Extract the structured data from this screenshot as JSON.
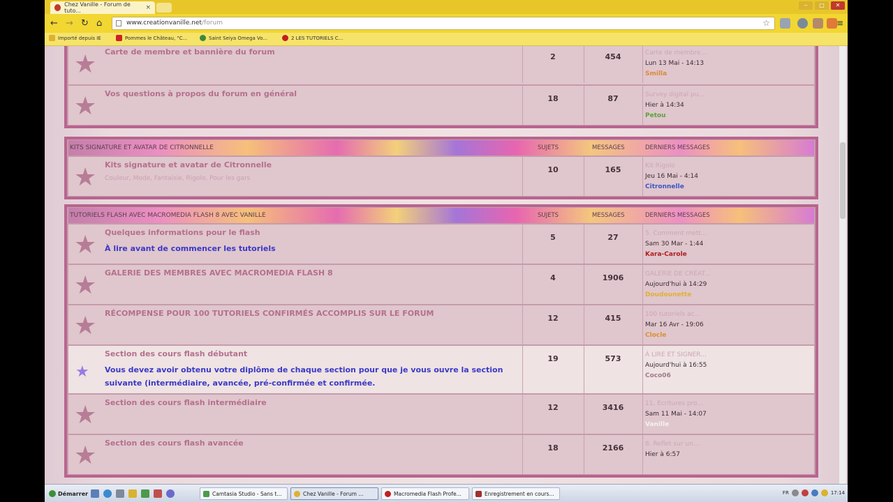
{
  "browser": {
    "tab_title": "Chez Vanille - Forum de tuto...",
    "tab_close": "×",
    "url_host": "www.creationvanille.net",
    "url_path": "/forum",
    "bookmarks": [
      "Importé depuis IE",
      "Pommes le Château, \"C...",
      "Saint Seiya Omega Vo...",
      "2 LES TUTORIELS C..."
    ],
    "colors": {
      "tabbar": "#e8c62a",
      "toolbar": "#f2d632"
    }
  },
  "categories": [
    {
      "title": "",
      "columns": [
        "",
        "",
        ""
      ],
      "forums": [
        {
          "name": "Carte de membre et bannière du forum",
          "upper": false,
          "topics": "2",
          "posts": "454",
          "last_title": "Carte de membre...",
          "last_date": "Lun 13 Mai - 14:13",
          "last_user": "Smilla",
          "user_color": "#d98a3a"
        },
        {
          "name": "Vos questions à propos du forum en général",
          "upper": false,
          "topics": "18",
          "posts": "87",
          "last_title": "Survey digital pu...",
          "last_date": "Hier à 14:34",
          "last_user": "Petou",
          "user_color": "#5aa33a"
        }
      ]
    },
    {
      "title": "KITS SIGNATURE ET AVATAR DE CITRONNELLE",
      "columns": [
        "Sujets",
        "Messages",
        "Derniers Messages"
      ],
      "forums": [
        {
          "name": "Kits signature et avatar de Citronnelle",
          "upper": false,
          "sub": "Couleur, Mode, Fantaisie, Rigolo, Pour les gars",
          "topics": "10",
          "posts": "165",
          "last_title": "Kit Rigolo",
          "last_date": "Jeu 16 Mai - 4:14",
          "last_user": "Citronnelle",
          "user_color": "#3a56c6"
        }
      ]
    },
    {
      "title": "TUTORIELS FLASH AVEC MACROMEDIA FLASH 8 AVEC VANILLE",
      "columns": [
        "Sujets",
        "Messages",
        "Derniers Messages"
      ],
      "forums": [
        {
          "name": "Quelques informations pour le flash",
          "upper": false,
          "desc": "À lire avant de commencer les tutoriels",
          "topics": "5",
          "posts": "27",
          "last_title": "5. Comment mett...",
          "last_date": "Sam 30 Mar - 1:44",
          "last_user": "Kara-Carole",
          "user_color": "#b02020"
        },
        {
          "name": "Galerie des membres avec Macromedia Flash 8",
          "upper": true,
          "topics": "4",
          "posts": "1906",
          "last_title": "GALERIE DE CRÉAT...",
          "last_date": "Aujourd'hui à 14:29",
          "last_user": "Doudounette",
          "user_color": "#e0b030"
        },
        {
          "name": "Récompense pour 100 tutoriels confirmés accomplis sur le forum",
          "upper": true,
          "topics": "12",
          "posts": "415",
          "last_title": "100 tutoriels ac...",
          "last_date": "Mar 16 Avr - 19:06",
          "last_user": "Clocle",
          "user_color": "#d99030"
        },
        {
          "name": "Section des cours flash débutant",
          "upper": false,
          "light": true,
          "blue_star": true,
          "desc": "Vous devez avoir obtenu votre diplôme de chaque section pour que je vous ouvre la section suivante (intermédiaire, avancée, pré-confirmée et confirmée.",
          "topics": "19",
          "posts": "573",
          "last_title": "À LIRE ET SIGNER...",
          "last_date": "Aujourd'hui à 16:55",
          "last_user": "Coco06",
          "user_color": "#a07a8a"
        },
        {
          "name": "Section des cours flash intermédiaire",
          "upper": false,
          "topics": "12",
          "posts": "3416",
          "last_title": "11. Ecritures pro...",
          "last_date": "Sam 11 Mai - 14:07",
          "last_user": "Vanille",
          "user_color": "#f4f0f0"
        },
        {
          "name": "Section des cours flash avancée",
          "upper": false,
          "topics": "18",
          "posts": "2166",
          "last_title": "8. Reflet sur un...",
          "last_date": "Hier à 6:57",
          "last_user": "",
          "user_color": "#a07a8a"
        }
      ]
    }
  ],
  "taskbar": {
    "start_label": "Démarrer",
    "tasks": [
      "Camtasia Studio - Sans t...",
      "Chez Vanille - Forum ...",
      "Macromedia Flash Profe...",
      "Enregistrement en cours..."
    ],
    "active_task": 1,
    "lang": "FR",
    "clock": "17:14"
  }
}
